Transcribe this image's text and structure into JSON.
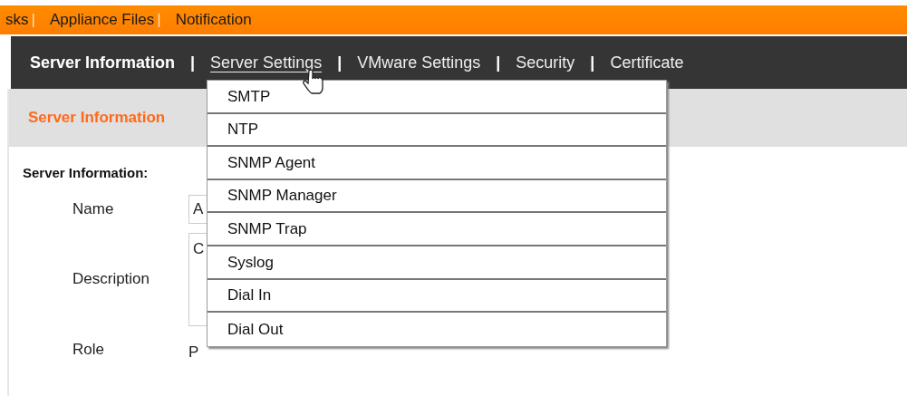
{
  "top_bar": {
    "separator": "|",
    "items": [
      "sks",
      "Appliance Files",
      "Notification"
    ]
  },
  "tabs": {
    "separator": "|",
    "items": [
      {
        "label": "Server Information",
        "selected": true,
        "hovered": false
      },
      {
        "label": "Server Settings",
        "selected": false,
        "hovered": true
      },
      {
        "label": "VMware Settings",
        "selected": false,
        "hovered": false
      },
      {
        "label": "Security",
        "selected": false,
        "hovered": false
      },
      {
        "label": "Certificate",
        "selected": false,
        "hovered": false
      }
    ]
  },
  "section_title": "Server Information",
  "form": {
    "heading": "Server Information:",
    "fields": [
      {
        "label": "Name",
        "kind": "input",
        "value": "A"
      },
      {
        "label": "Description",
        "kind": "textarea",
        "value": "C"
      },
      {
        "label": "Role",
        "kind": "text",
        "value": "P"
      }
    ]
  },
  "dropdown": {
    "items": [
      "SMTP",
      "NTP",
      "SNMP Agent",
      "SNMP Manager",
      "SNMP Trap",
      "Syslog",
      "Dial In",
      "Dial Out"
    ]
  }
}
